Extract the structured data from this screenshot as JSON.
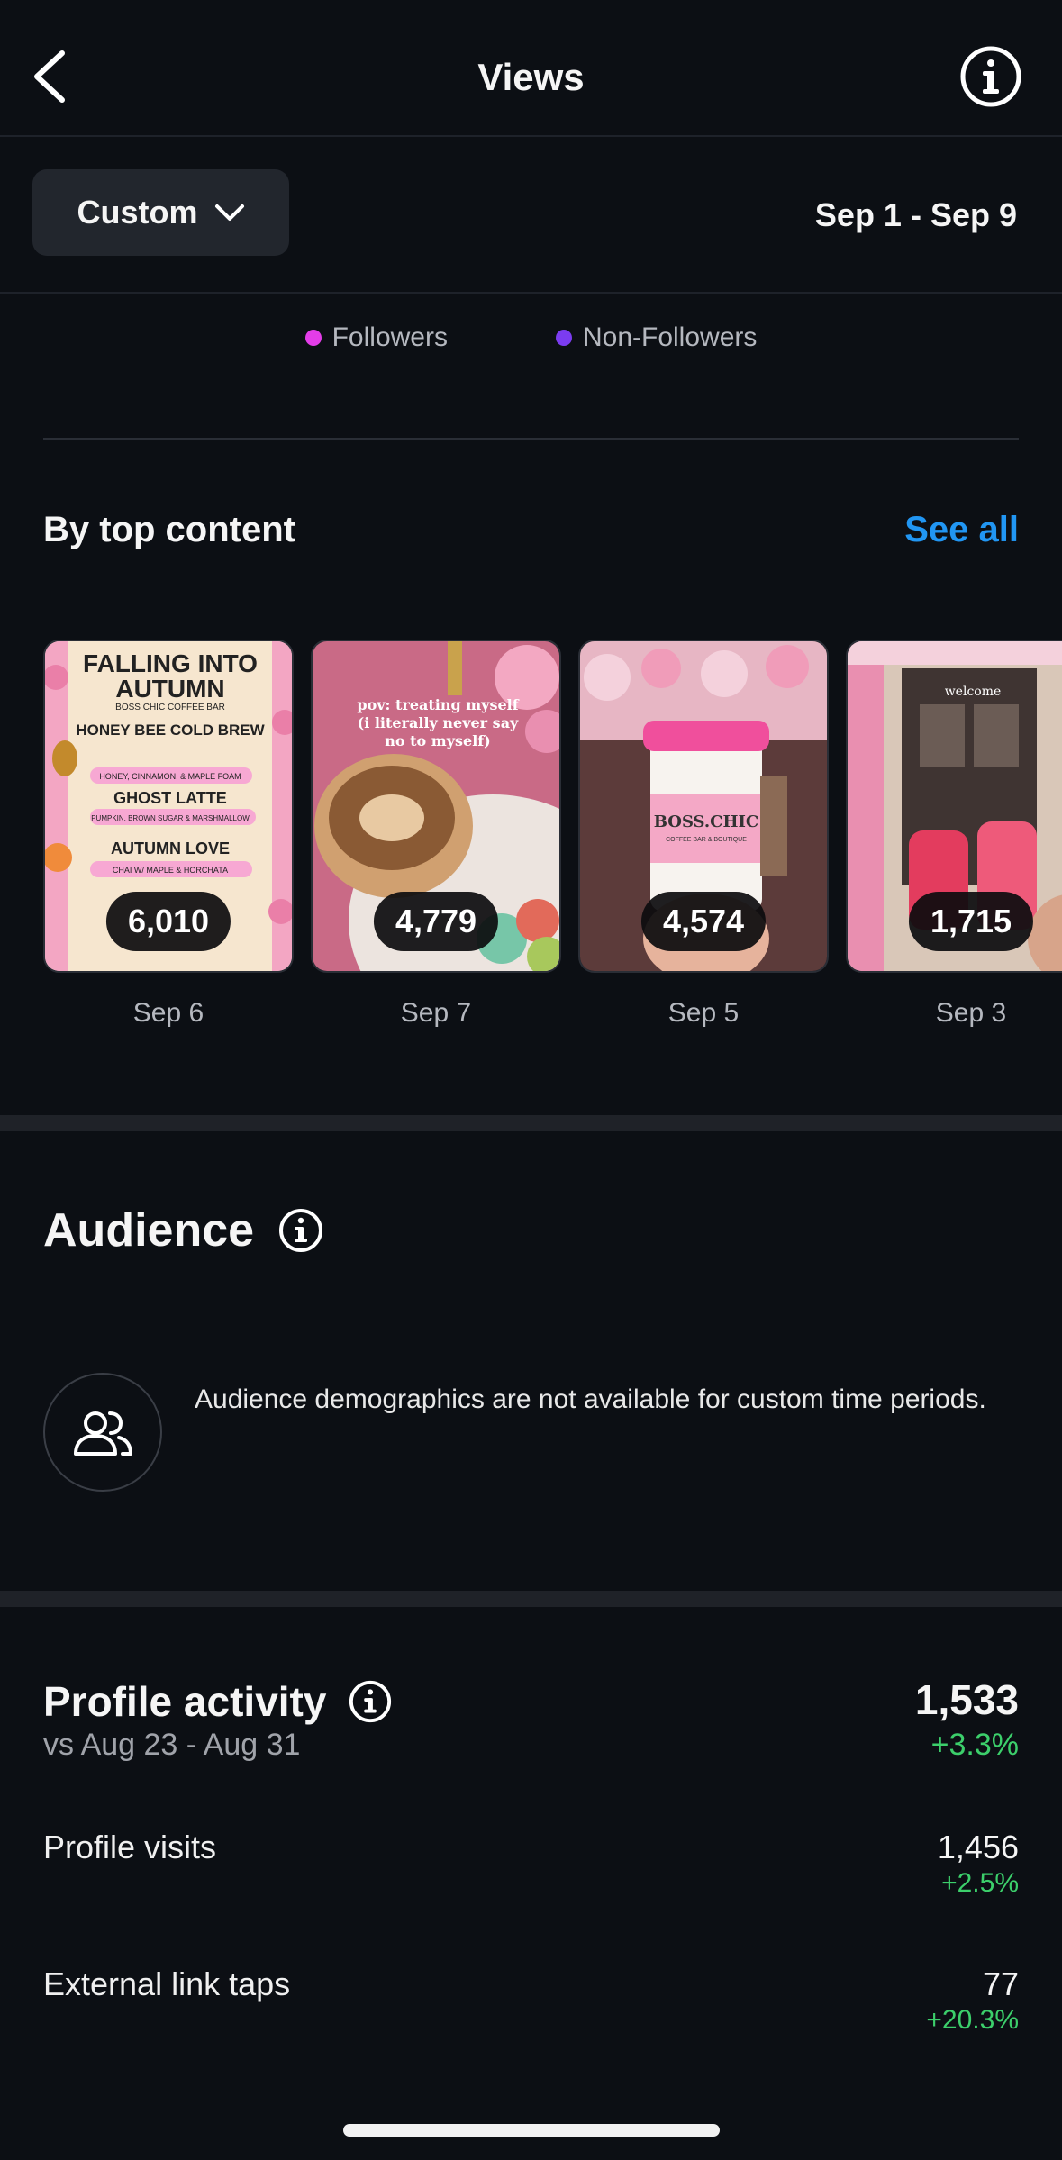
{
  "header": {
    "title": "Views",
    "back_icon": "chevron-left-icon",
    "info_icon": "info-icon"
  },
  "filter": {
    "range_label": "Custom",
    "date_range": "Sep 1 - Sep 9"
  },
  "legend": [
    {
      "label": "Followers",
      "color": "#e33de8"
    },
    {
      "label": "Non-Followers",
      "color": "#7b3cf0"
    }
  ],
  "top_content": {
    "title": "By top content",
    "see_all": "See all",
    "items": [
      {
        "views": "6,010",
        "date": "Sep 6",
        "overlay": [
          "FALLING INTO",
          "AUTUMN",
          "BOSS CHIC COFFEE BAR",
          "HONEY BEE COLD BREW",
          "HONEY, CINNAMON, & MAPLE FOAM",
          "GHOST LATTE",
          "PUMPKIN, BROWN SUGAR & MARSHMALLOW",
          "AUTUMN LOVE",
          "CHAI W/ MAPLE & HORCHATA"
        ]
      },
      {
        "views": "4,779",
        "date": "Sep 7",
        "overlay": [
          "pov: treating myself",
          "(i literally never say",
          "no to myself)"
        ]
      },
      {
        "views": "4,574",
        "date": "Sep 5",
        "overlay": [
          "BOSS.CHIC",
          "COFFEE BAR & BOUTIQUE"
        ]
      },
      {
        "views": "1,715",
        "date": "Sep 3",
        "overlay": [
          "welcome"
        ]
      }
    ]
  },
  "audience": {
    "title": "Audience",
    "note": "Audience demographics are not available for custom time periods."
  },
  "profile_activity": {
    "title": "Profile activity",
    "comparison": "vs Aug 23 - Aug 31",
    "total": "1,533",
    "total_change": "+3.3%",
    "metrics": [
      {
        "label": "Profile visits",
        "value": "1,456",
        "change": "+2.5%"
      },
      {
        "label": "External link taps",
        "value": "77",
        "change": "+20.3%"
      }
    ]
  },
  "colors": {
    "background": "#0c0f14",
    "accent": "#2196f3",
    "positive": "#3ccf6b"
  }
}
